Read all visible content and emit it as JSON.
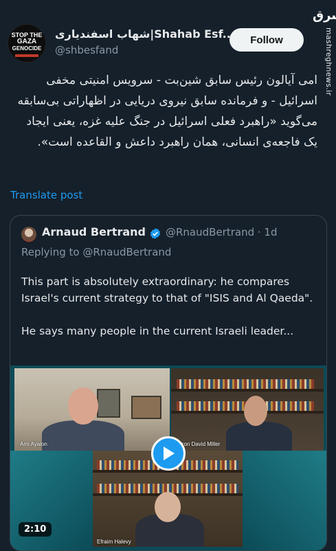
{
  "watermark": {
    "logo": "مشرق",
    "url": "mashreghnews.ir"
  },
  "avatar": {
    "line1": "STOP THE",
    "line2": "GAZA",
    "line3": "GENOCIDE"
  },
  "author": {
    "display_name": "شهاب اسفندیاری|Shahab Esf...",
    "handle": "@shbesfand"
  },
  "follow_label": "Follow",
  "post_text": "امی آیالون رئیس سابق شین‌بت - سرویس امنیتی مخفی اسرائیل - و فرمانده سابق نیروی دریایی در اظهاراتی بی‌سابقه می‌گوید «راهبرد فعلی اسرائیل در جنگ علیه غزه، یعنی ایجاد یک فاجعه‌ی انسانی، همان راهبرد داعش و القاعده است».",
  "translate_label": "Translate post",
  "quote": {
    "name": "Arnaud Bertrand",
    "meta": "@RnaudBertrand · 1d",
    "replying": "Replying to @RnaudBertrand",
    "para1": "This part is absolutely extraordinary: he compares Israel's current strategy to that of \"ISIS and Al Qaeda\".",
    "para2": "He says many people in the current Israeli leader...",
    "video": {
      "labels": [
        "Ami Ayalon",
        "Aaron David Miller",
        "Efraim Halevy"
      ],
      "duration": "2:10"
    }
  },
  "colors": {
    "background": "#15202b",
    "link": "#1d9bf0",
    "secondary_text": "#8b98a5",
    "border": "#38444d"
  }
}
